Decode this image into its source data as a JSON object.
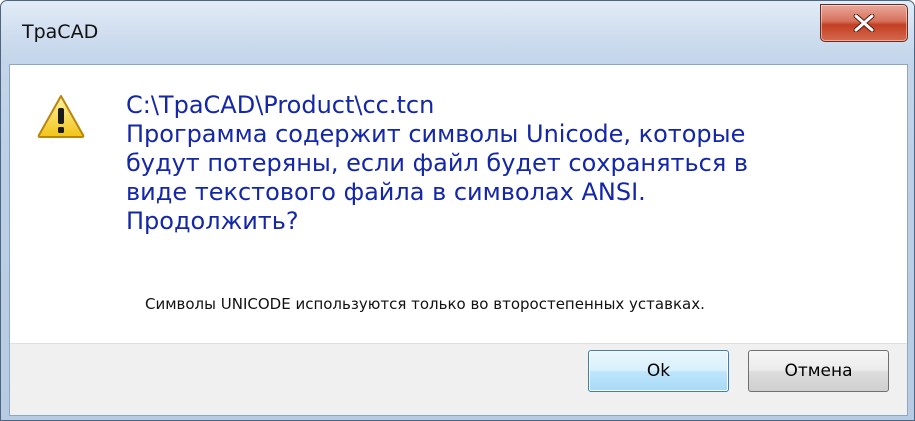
{
  "window": {
    "title": "TpaCAD"
  },
  "dialog": {
    "icon": "warning-icon",
    "message_lines": [
      "C:\\TpaCAD\\Product\\cc.tcn",
      "Программа содержит символы Unicode, которые",
      "будут потеряны, если файл будет сохраняться в",
      "виде текстового файла в символах ANSI.",
      "Продолжить?"
    ],
    "note": "Символы UNICODE используются только во второстепенных уставках.",
    "ok_label": "Ok",
    "cancel_label": "Отмена"
  },
  "colors": {
    "message_text": "#1327a8",
    "close_button": "#c23f23",
    "footer_bg": "#f0f0f0"
  }
}
